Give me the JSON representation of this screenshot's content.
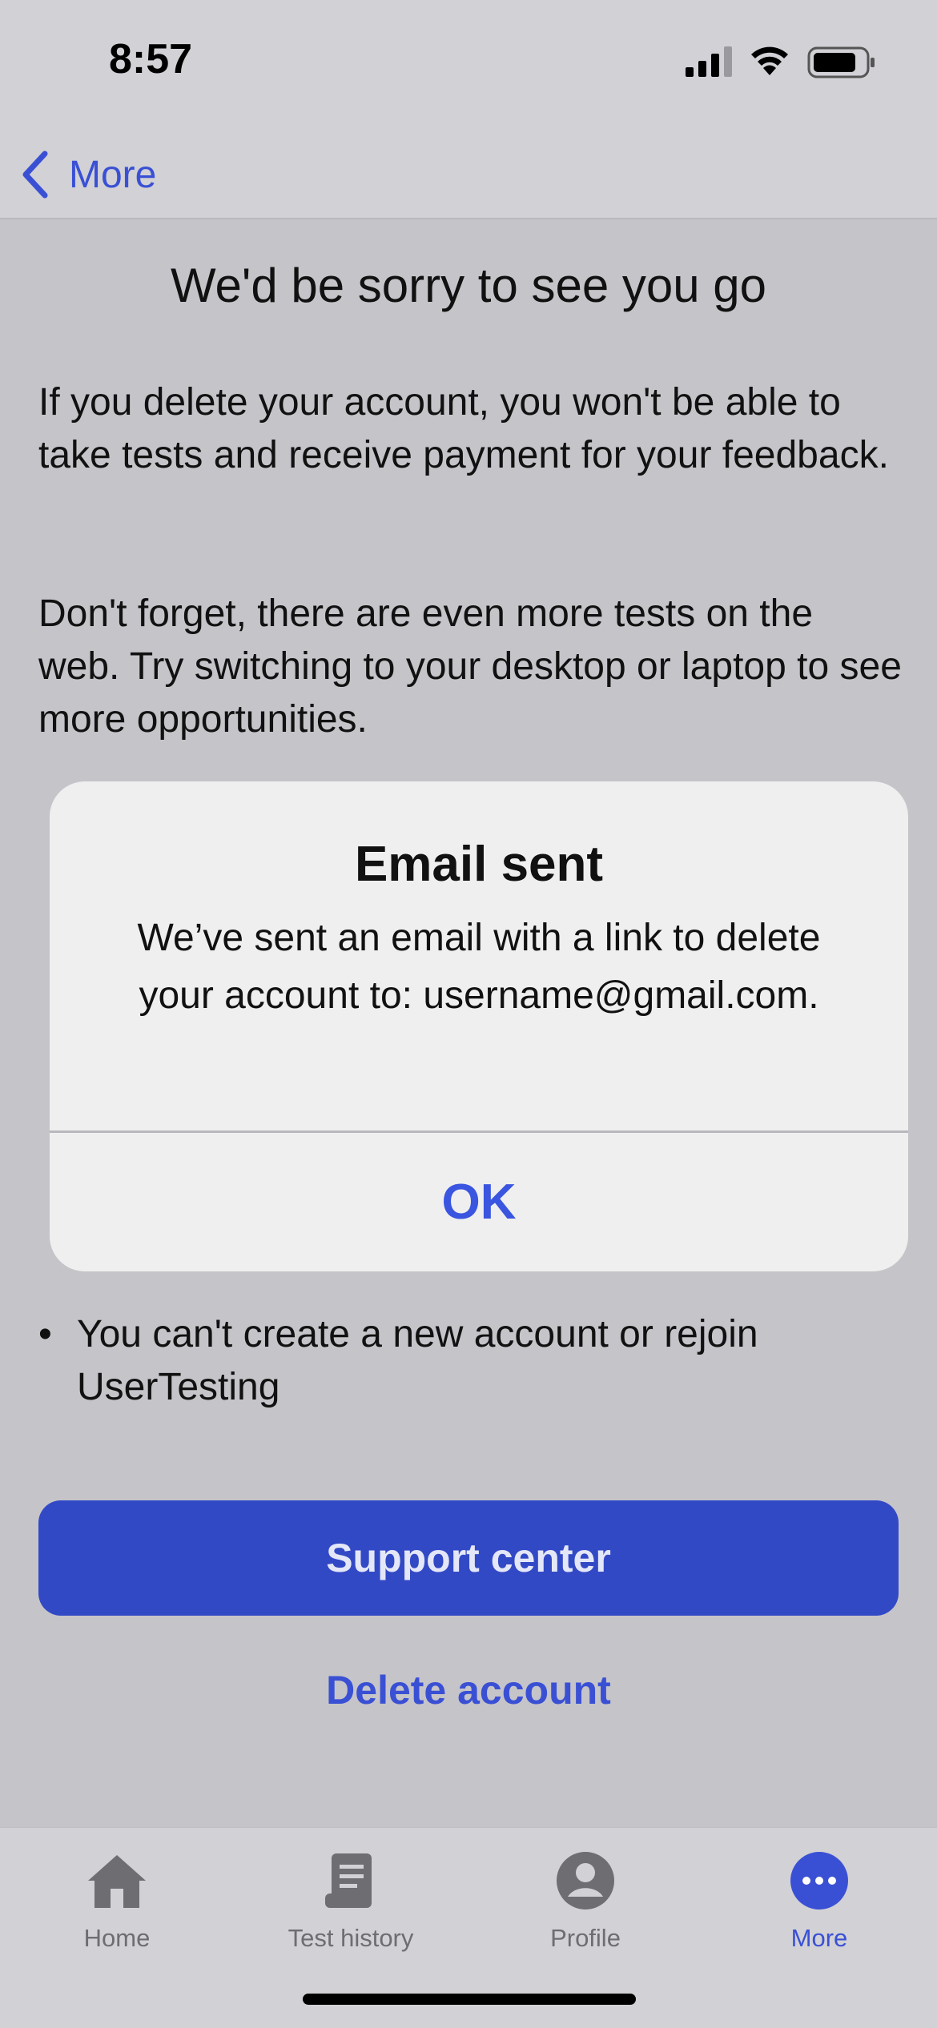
{
  "status_bar": {
    "time": "8:57"
  },
  "nav": {
    "back_label": "More"
  },
  "page": {
    "title": "We'd be sorry to see you go",
    "paragraph_1": "If you delete your account, you won't be able to take tests and receive payment for your feedback.",
    "paragraph_2": "Don't forget, there are even more tests on the web. Try switching to your desktop or laptop to see more opportunities.",
    "bullet_2": "You can't create a new account or rejoin UserTesting",
    "support_button": "Support center",
    "delete_link": "Delete account"
  },
  "alert": {
    "title": "Email sent",
    "message": "We’ve sent an email with a link to delete your account to: username@gmail.com.",
    "ok_label": "OK"
  },
  "tabs": [
    {
      "label": "Home",
      "icon": "home-icon"
    },
    {
      "label": "Test history",
      "icon": "test-history-icon"
    },
    {
      "label": "Profile",
      "icon": "profile-icon"
    },
    {
      "label": "More",
      "icon": "more-icon",
      "active": true
    }
  ],
  "colors": {
    "accent": "#3a50d4",
    "button": "#3249c6",
    "dimmed_background": "#c5c4c9"
  }
}
